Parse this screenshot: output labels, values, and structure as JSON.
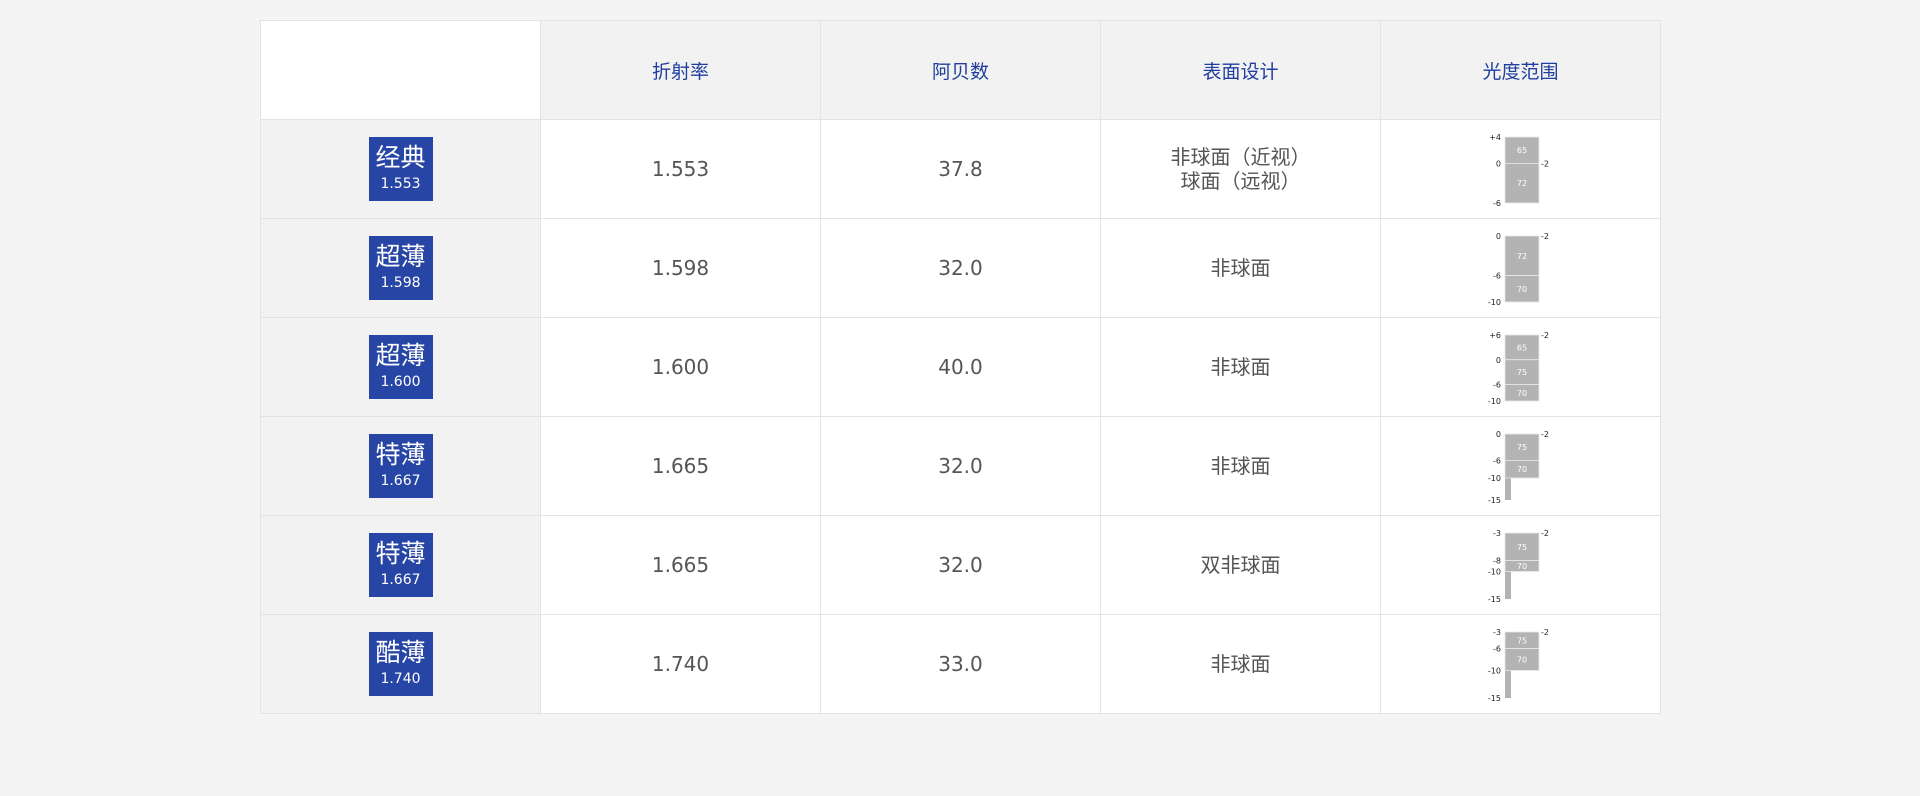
{
  "table": {
    "headers": [
      "折射率",
      "阿贝数",
      "表面设计",
      "光度范围"
    ],
    "rows": [
      {
        "name": "经典",
        "index_label": "1.553",
        "refractive_index": "1.553",
        "abbe": "37.8",
        "design": [
          "非球面（近视）",
          "球面（远视）"
        ],
        "range": {
          "top": "+4",
          "bottom": "-6",
          "cyl": "-2",
          "segments": [
            {
              "label": "65",
              "from": 4,
              "to": 0
            },
            {
              "label": "72",
              "from": 0,
              "to": -6
            }
          ],
          "ticks": [
            "+4",
            "0",
            "-6"
          ]
        }
      },
      {
        "name": "超薄",
        "index_label": "1.598",
        "refractive_index": "1.598",
        "abbe": "32.0",
        "design": [
          "非球面"
        ],
        "range": {
          "top": "0",
          "bottom": "-10",
          "cyl": "-2",
          "segments": [
            {
              "label": "72",
              "from": 0,
              "to": -6
            },
            {
              "label": "70",
              "from": -6,
              "to": -10
            }
          ],
          "ticks": [
            "0",
            "-6",
            "-10"
          ]
        }
      },
      {
        "name": "超薄",
        "index_label": "1.600",
        "refractive_index": "1.600",
        "abbe": "40.0",
        "design": [
          "非球面"
        ],
        "range": {
          "top": "+6",
          "bottom": "-10",
          "cyl": "-2",
          "segments": [
            {
              "label": "65",
              "from": 6,
              "to": 0
            },
            {
              "label": "75",
              "from": 0,
              "to": -6
            },
            {
              "label": "70",
              "from": -6,
              "to": -10
            }
          ],
          "ticks": [
            "+6",
            "0",
            "-6",
            "-10"
          ]
        }
      },
      {
        "name": "特薄",
        "index_label": "1.667",
        "refractive_index": "1.665",
        "abbe": "32.0",
        "design": [
          "非球面"
        ],
        "range": {
          "top": "0",
          "bottom": "-15",
          "cyl": "-2",
          "segments": [
            {
              "label": "75",
              "from": 0,
              "to": -6
            },
            {
              "label": "70",
              "from": -6,
              "to": -10
            }
          ],
          "tail_to": -15,
          "ticks": [
            "0",
            "-6",
            "-10",
            "-15"
          ]
        }
      },
      {
        "name": "特薄",
        "index_label": "1.667",
        "refractive_index": "1.665",
        "abbe": "32.0",
        "design": [
          "双非球面"
        ],
        "range": {
          "top": "-3",
          "bottom": "-15",
          "cyl": "-2",
          "segments": [
            {
              "label": "75",
              "from": -3,
              "to": -8
            },
            {
              "label": "70",
              "from": -8,
              "to": -10
            }
          ],
          "tail_to": -15,
          "ticks": [
            "-3",
            "-8",
            "-10",
            "-15"
          ]
        }
      },
      {
        "name": "酷薄",
        "index_label": "1.740",
        "refractive_index": "1.740",
        "abbe": "33.0",
        "design": [
          "非球面"
        ],
        "range": {
          "top": "-3",
          "bottom": "-15",
          "cyl": "-2",
          "segments": [
            {
              "label": "75",
              "from": -3,
              "to": -6
            },
            {
              "label": "70",
              "from": -6,
              "to": -10
            }
          ],
          "tail_to": -15,
          "ticks": [
            "-3",
            "-6",
            "-10",
            "-15"
          ]
        }
      }
    ]
  },
  "colors": {
    "header_text": "#1f3e9e",
    "badge_bg": "#2745a4",
    "bar_fill": "#b3b3b3"
  }
}
